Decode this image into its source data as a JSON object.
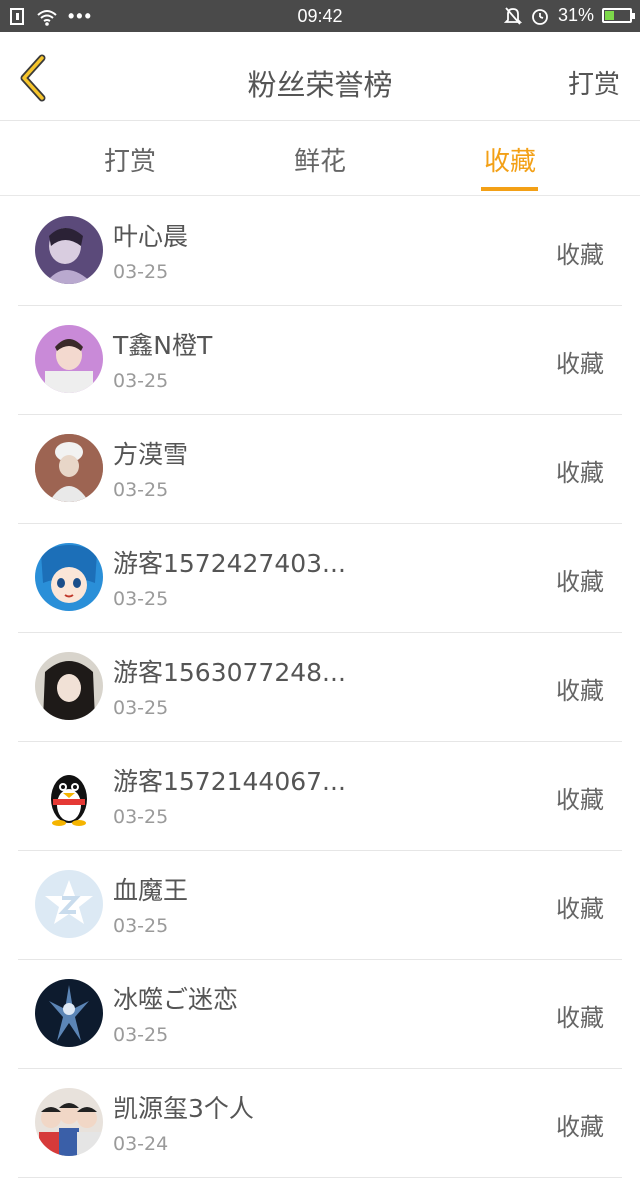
{
  "status_bar": {
    "time": "09:42",
    "battery": "31%",
    "battery_level": 0.31,
    "dots": "•••"
  },
  "header": {
    "title": "粉丝荣誉榜",
    "right_action": "打赏",
    "back_icon": "chevron-left-icon",
    "accent_color": "#f3a016"
  },
  "tabs": [
    {
      "label": "打赏",
      "active": false
    },
    {
      "label": "鲜花",
      "active": false
    },
    {
      "label": "收藏",
      "active": true
    }
  ],
  "list": [
    {
      "name": "叶心晨",
      "date": "03-25",
      "action": "收藏"
    },
    {
      "name": "T鑫N橙T",
      "date": "03-25",
      "action": "收藏"
    },
    {
      "name": "方漠雪",
      "date": "03-25",
      "action": "收藏"
    },
    {
      "name": "游客1572427403...",
      "date": "03-25",
      "action": "收藏"
    },
    {
      "name": "游客1563077248...",
      "date": "03-25",
      "action": "收藏"
    },
    {
      "name": "游客1572144067...",
      "date": "03-25",
      "action": "收藏"
    },
    {
      "name": "血魔王",
      "date": "03-25",
      "action": "收藏"
    },
    {
      "name": "冰噬ご迷恋",
      "date": "03-25",
      "action": "收藏"
    },
    {
      "name": "凯源玺3个人",
      "date": "03-24",
      "action": "收藏"
    }
  ]
}
